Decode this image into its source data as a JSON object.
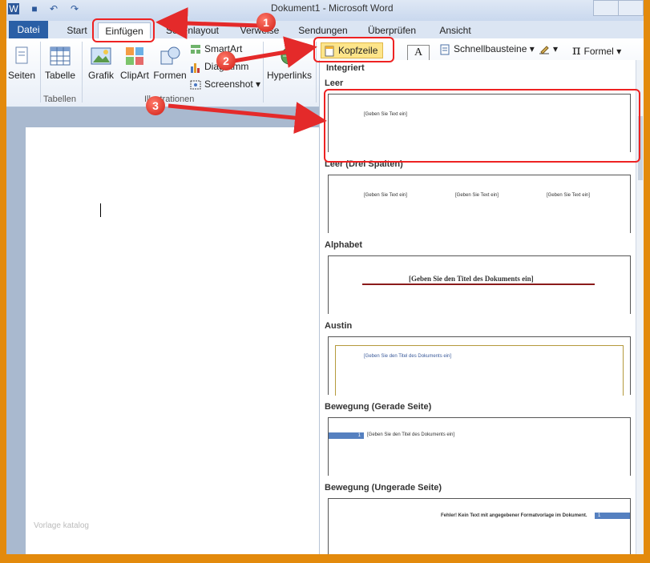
{
  "title_bar": {
    "document_title": "Dokument1 - Microsoft Word",
    "quick_access": [
      "word-icon",
      "save-icon",
      "undo-icon",
      "redo-icon"
    ]
  },
  "tabs": [
    {
      "label": "Datei"
    },
    {
      "label": "Start"
    },
    {
      "label": "Einfügen"
    },
    {
      "label": "Seitenlayout"
    },
    {
      "label": "Verweise"
    },
    {
      "label": "Sendungen"
    },
    {
      "label": "Überprüfen"
    },
    {
      "label": "Ansicht"
    }
  ],
  "ribbon": {
    "seiten": "Seiten",
    "tabelle": "Tabelle",
    "tabellen_group": "Tabellen",
    "grafik": "Grafik",
    "clipart": "ClipArt",
    "formen": "Formen",
    "smartart": "SmartArt",
    "diagramm": "Diagramm",
    "screenshot": "Screenshot",
    "illustrationen_group": "Illustrationen",
    "hyperlinks": "Hyperlinks",
    "kopfzeile": "Kopfzeile",
    "schnellbausteine": "Schnellbausteine",
    "formel": "Formel",
    "formel_symbol": "π"
  },
  "gallery": {
    "section_heading": "Integriert",
    "placeholder": "[Geben Sie Text ein]",
    "title_placeholder": "[Geben Sie den Titel des Dokuments ein]",
    "error_text": "Fehler! Kein Text mit angegebener Formatvorlage im Dokument.",
    "page_number": "1",
    "items": [
      {
        "name": "Leer"
      },
      {
        "name": "Leer (Drei Spalten)"
      },
      {
        "name": "Alphabet"
      },
      {
        "name": "Austin"
      },
      {
        "name": "Bewegung (Gerade Seite)"
      },
      {
        "name": "Bewegung (Ungerade Seite)"
      }
    ]
  },
  "annotations": {
    "step1": "1",
    "step2": "2",
    "step3": "3"
  },
  "watermark": "Vorlage katalog",
  "colors": {
    "accent": "#2a5fa6",
    "highlight": "#e22222",
    "frame": "#e38a0c"
  }
}
